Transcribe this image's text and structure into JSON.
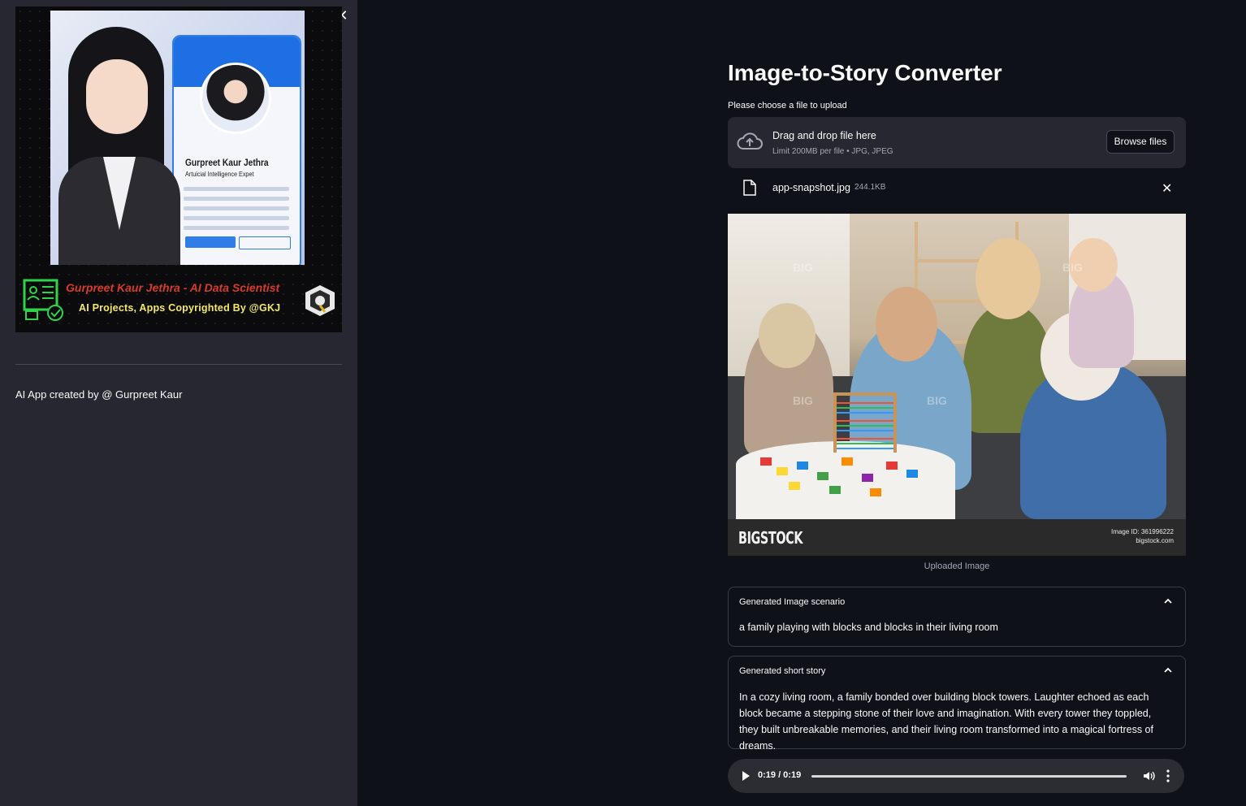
{
  "sidebar": {
    "banner": {
      "profile_name": "Gurpreet Kaur Jethra",
      "profile_role": "Artuicial Intelligence Expet",
      "footer_line1": "Gurpreet Kaur Jethra - AI Data Scientist",
      "footer_line2": "AI Projects, Apps Copyrighted By @GKJ"
    },
    "close_icon": "close-icon",
    "credit": "AI App created by @ Gurpreet Kaur"
  },
  "main": {
    "title": "Image-to-Story Converter",
    "uploader": {
      "label": "Please choose a file to upload",
      "drop_title": "Drag and drop file here",
      "drop_limit": "Limit 200MB per file • JPG, JPEG",
      "browse_label": "Browse files",
      "icon": "cloud-upload-icon"
    },
    "file": {
      "name": "app-snapshot.jpg",
      "size": "244.1KB",
      "icon": "file-icon"
    },
    "image": {
      "brand": "BIGSTOCK",
      "image_id": "Image ID: 361996222",
      "site": "bigstock.com",
      "watermark": "BIG",
      "caption": "Uploaded Image"
    },
    "scenario": {
      "header": "Generated Image scenario",
      "text": "a family playing with blocks and blocks in their living room"
    },
    "story": {
      "header": "Generated short story",
      "text": "In a cozy living room, a family bonded over building block towers. Laughter echoed as each block became a stepping stone of their love and imagination. With every tower they toppled, they built unbreakable memories, and their living room transformed into a magical fortress of dreams."
    },
    "audio": {
      "time": "0:19 / 0:19",
      "progress": 1.0
    }
  },
  "colors": {
    "app_bg": "#0e1117",
    "sidebar_bg": "#262730",
    "accent_blue": "#1d6fe3",
    "banner_red": "#d83a2a",
    "banner_yellow": "#f3e86a"
  }
}
